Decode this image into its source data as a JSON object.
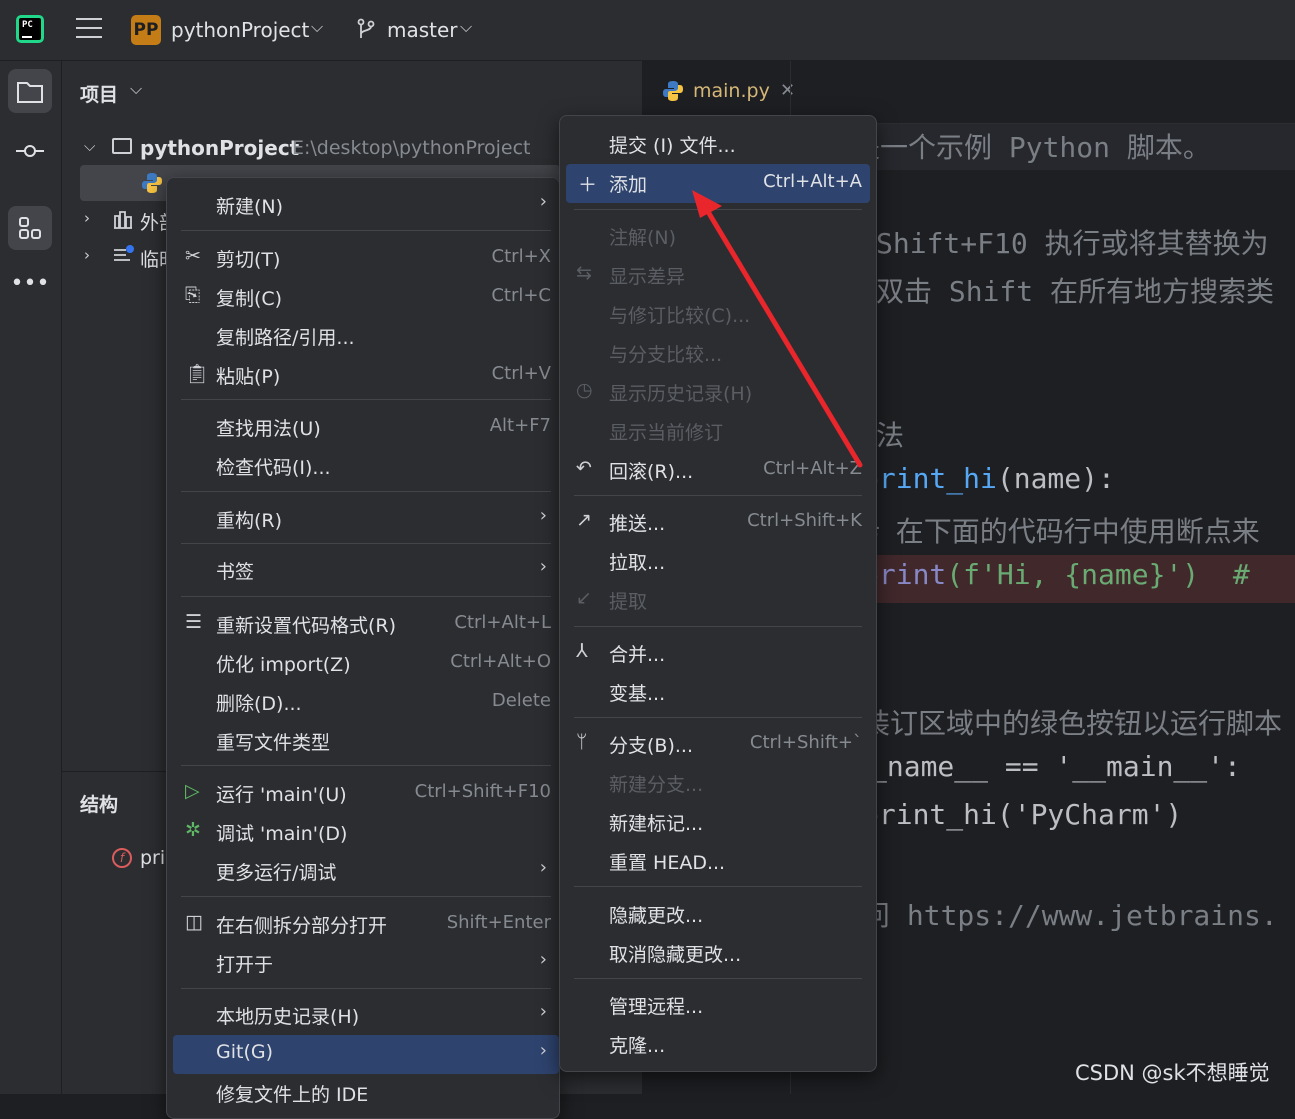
{
  "titlebar": {
    "project_badge": "PP",
    "project_name": "pythonProject",
    "branch": "master"
  },
  "project_panel": {
    "title": "项目",
    "root_name": "pythonProject",
    "root_path": "E:\\desktop\\pythonProject",
    "external_label": "外部",
    "scratch_label": "临时"
  },
  "structure_panel": {
    "title": "结构",
    "func_item": "pri"
  },
  "editor": {
    "tab_label": "main.py",
    "lines": [
      {
        "text": "是一个示例 Python 脚本。",
        "kind": "comment"
      },
      {
        "text": "Shift+F10 执行或将其替换为",
        "kind": "comment"
      },
      {
        "text": "双击 Shift 在所有地方搜索类",
        "kind": "comment"
      },
      {
        "text": "法",
        "kind": "comment"
      },
      {
        "text": "print_hi",
        "kind": "fn"
      },
      {
        "text": "(name):",
        "kind": "param"
      },
      {
        "text": "# 在下面的代码行中使用断点来",
        "kind": "comment"
      },
      {
        "text": "print",
        "kind": "fn"
      },
      {
        "text": "(f'Hi, {name}')  #",
        "kind": "str"
      },
      {
        "text": "装订区域中的绿色按钮以运行脚本",
        "kind": "comment"
      },
      {
        "text": "_name__ == '__main__':",
        "kind": "param"
      },
      {
        "text": "print_hi('PyCharm')",
        "kind": "fn"
      },
      {
        "text": "问 https://www.jetbrains.",
        "kind": "comment"
      }
    ]
  },
  "context_menu": {
    "items": [
      {
        "label": "新建(N)",
        "shortcut": "",
        "submenu": true
      },
      {
        "label": "剪切(T)",
        "shortcut": "Ctrl+X"
      },
      {
        "label": "复制(C)",
        "shortcut": "Ctrl+C"
      },
      {
        "label": "复制路径/引用...",
        "shortcut": ""
      },
      {
        "label": "粘贴(P)",
        "shortcut": "Ctrl+V"
      },
      {
        "label": "查找用法(U)",
        "shortcut": "Alt+F7"
      },
      {
        "label": "检查代码(I)...",
        "shortcut": ""
      },
      {
        "label": "重构(R)",
        "shortcut": "",
        "submenu": true
      },
      {
        "label": "书签",
        "shortcut": "",
        "submenu": true
      },
      {
        "label": "重新设置代码格式(R)",
        "shortcut": "Ctrl+Alt+L"
      },
      {
        "label": "优化 import(Z)",
        "shortcut": "Ctrl+Alt+O"
      },
      {
        "label": "删除(D)...",
        "shortcut": "Delete"
      },
      {
        "label": "重写文件类型",
        "shortcut": ""
      },
      {
        "label": "运行 'main'(U)",
        "shortcut": "Ctrl+Shift+F10"
      },
      {
        "label": "调试 'main'(D)",
        "shortcut": ""
      },
      {
        "label": "更多运行/调试",
        "shortcut": "",
        "submenu": true
      },
      {
        "label": "在右侧拆分部分打开",
        "shortcut": "Shift+Enter"
      },
      {
        "label": "打开于",
        "shortcut": "",
        "submenu": true
      },
      {
        "label": "本地历史记录(H)",
        "shortcut": "",
        "submenu": true
      },
      {
        "label": "Git(G)",
        "shortcut": "",
        "submenu": true,
        "highlighted": true
      },
      {
        "label": "修复文件上的 IDE",
        "shortcut": ""
      }
    ]
  },
  "git_menu": {
    "items": [
      {
        "label": "提交 (I) 文件...",
        "shortcut": ""
      },
      {
        "label": "添加",
        "shortcut": "Ctrl+Alt+A",
        "highlighted": true
      },
      {
        "label": "注解(N)",
        "shortcut": "",
        "disabled": true
      },
      {
        "label": "显示差异",
        "shortcut": "",
        "disabled": true
      },
      {
        "label": "与修订比较(C)...",
        "shortcut": "",
        "disabled": true
      },
      {
        "label": "与分支比较...",
        "shortcut": "",
        "disabled": true
      },
      {
        "label": "显示历史记录(H)",
        "shortcut": "",
        "disabled": true
      },
      {
        "label": "显示当前修订",
        "shortcut": "",
        "disabled": true
      },
      {
        "label": "回滚(R)...",
        "shortcut": "Ctrl+Alt+Z"
      },
      {
        "label": "推送...",
        "shortcut": "Ctrl+Shift+K"
      },
      {
        "label": "拉取...",
        "shortcut": ""
      },
      {
        "label": "提取",
        "shortcut": "",
        "disabled": true
      },
      {
        "label": "合并...",
        "shortcut": ""
      },
      {
        "label": "变基...",
        "shortcut": ""
      },
      {
        "label": "分支(B)...",
        "shortcut": "Ctrl+Shift+`"
      },
      {
        "label": "新建分支...",
        "shortcut": "",
        "disabled": true
      },
      {
        "label": "新建标记...",
        "shortcut": ""
      },
      {
        "label": "重置 HEAD...",
        "shortcut": ""
      },
      {
        "label": "隐藏更改...",
        "shortcut": ""
      },
      {
        "label": "取消隐藏更改...",
        "shortcut": ""
      },
      {
        "label": "管理远程...",
        "shortcut": ""
      },
      {
        "label": "克隆...",
        "shortcut": ""
      }
    ]
  },
  "watermark": "CSDN @sk不想睡觉",
  "colors": {
    "accent": "#3574f0",
    "highlight": "#2e436e",
    "annotation_arrow": "#e8262b"
  }
}
